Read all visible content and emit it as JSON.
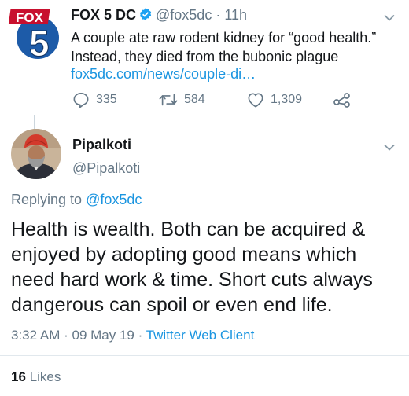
{
  "source_tweet": {
    "display_name": "FOX 5 DC",
    "handle": "@fox5dc",
    "separator": " · ",
    "time_ago": "11h",
    "text": "A couple ate raw rodent kidney for “good health.” Instead, they died from the bubonic plague",
    "link": "fox5dc.com/news/couple-di…",
    "avatar": {
      "brand_text": "FOX",
      "number": "5",
      "brand_color": "#c8102e",
      "number_bg": "#1d5ba8"
    },
    "actions": {
      "replies": "335",
      "retweets": "584",
      "likes": "1,309"
    },
    "icons": [
      "verified-badge-icon",
      "chevron-down-icon",
      "reply-icon",
      "retweet-icon",
      "like-icon",
      "share-icon"
    ]
  },
  "reply_tweet": {
    "display_name": "Pipalkoti",
    "handle": "@Pipalkoti",
    "replying_prefix": "Replying to ",
    "replying_to": "@fox5dc",
    "text": "Health is wealth. Both can be acquired & enjoyed by adopting good means which need hard work & time. Short cuts always dangerous can spoil or even end life.",
    "time": "3:32 AM",
    "meta_separator": " · ",
    "date": "09 May 19",
    "client": "Twitter Web Client",
    "likes_count": "16",
    "likes_label": "Likes"
  },
  "colors": {
    "link_blue": "#1b95e0",
    "muted_gray": "#657786",
    "text_dark": "#14171a",
    "divider": "#e1e8ed"
  }
}
